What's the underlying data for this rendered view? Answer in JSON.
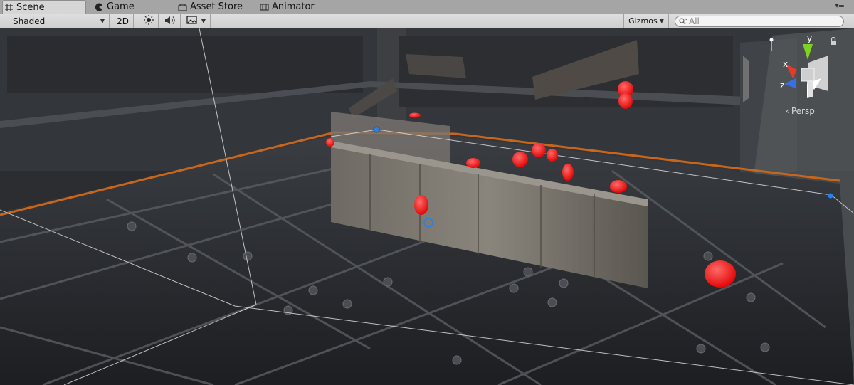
{
  "tabs": [
    {
      "label": "Scene",
      "icon": "grid-icon",
      "active": true
    },
    {
      "label": "Game",
      "icon": "pacman-icon",
      "active": false
    },
    {
      "label": "Asset Store",
      "icon": "store-icon",
      "active": false
    },
    {
      "label": "Animator",
      "icon": "animator-icon",
      "active": false
    }
  ],
  "toolbar": {
    "shading_mode": "Shaded",
    "mode_2d": "2D",
    "lighting_icon": "sun-icon",
    "audio_icon": "speaker-icon",
    "effects_icon": "image-icon",
    "gizmos_label": "Gizmos",
    "search_placeholder": "All"
  },
  "scene": {
    "projection_label": "Persp",
    "axis_labels": {
      "y": "y",
      "x": "x",
      "z": "z"
    },
    "colors": {
      "sphere": "#ff2020",
      "axis_x": "#e23b2a",
      "axis_y": "#7ed321",
      "axis_z": "#3a6ee8",
      "highlight_edge": "#c8661b",
      "handle": "#2f7fe0"
    }
  }
}
